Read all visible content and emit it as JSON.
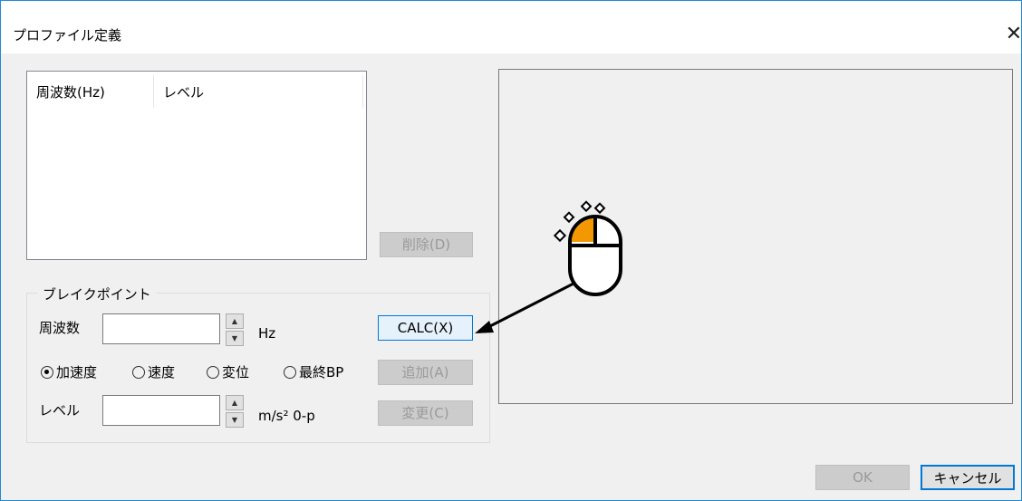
{
  "window": {
    "title": "プロファイル定義",
    "close_glyph": "✕"
  },
  "list": {
    "columns": [
      "周波数(Hz)",
      "レベル"
    ]
  },
  "buttons": {
    "delete": "削除(D)",
    "calc": "CALC(X)",
    "add": "追加(A)",
    "change": "変更(C)",
    "ok": "OK",
    "cancel": "キャンセル"
  },
  "breakpoint": {
    "group_label": "ブレイクポイント",
    "freq_label": "周波数",
    "freq_value": "",
    "freq_unit": "Hz",
    "level_label": "レベル",
    "level_value": "",
    "level_unit": "m/s² 0-p"
  },
  "radios": [
    {
      "label": "加速度",
      "selected": true
    },
    {
      "label": "速度",
      "selected": false
    },
    {
      "label": "変位",
      "selected": false
    },
    {
      "label": "最終BP",
      "selected": false
    }
  ],
  "colors": {
    "accent": "#0078d7",
    "mouse_button": "#f39800"
  },
  "icons": {
    "mouse": "mouse-left-click-icon",
    "arrow": "pointer-arrow"
  }
}
